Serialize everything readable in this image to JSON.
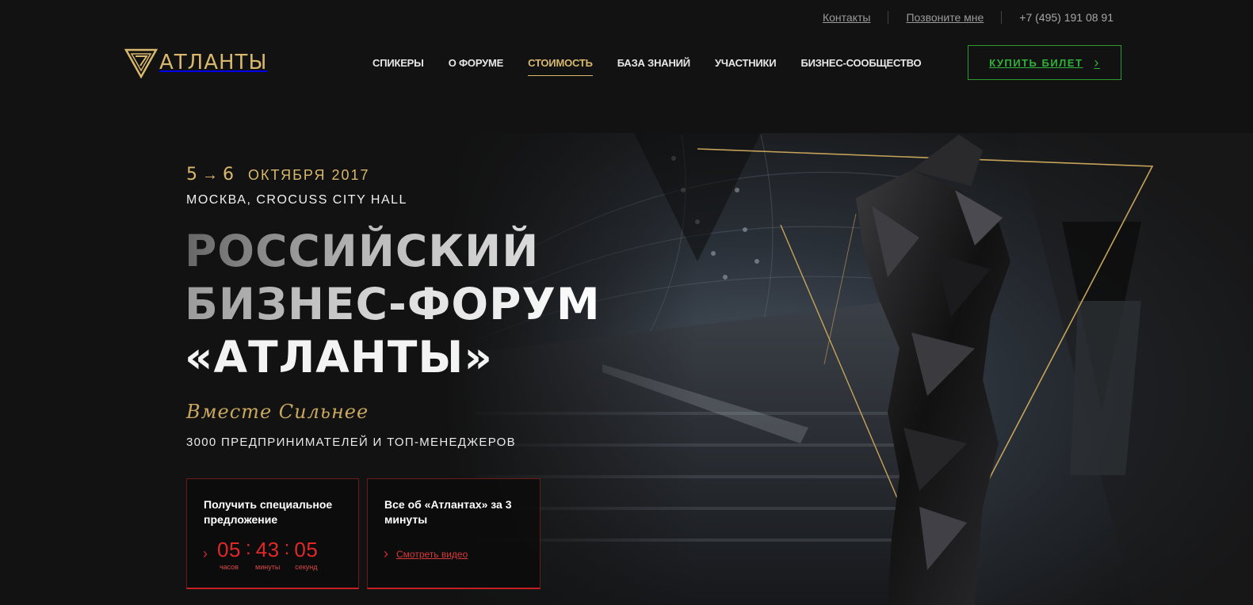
{
  "topbar": {
    "contacts": "Контакты",
    "callback": "Позвоните мне",
    "phone": "+7 (495) 191 08 91"
  },
  "logo": {
    "text": "АТЛАНТЫ",
    "icon": "atlanty-triangle-logo"
  },
  "nav": {
    "items": [
      {
        "label": "Спикеры"
      },
      {
        "label": "О форуме"
      },
      {
        "label": "Стоимость",
        "active": true
      },
      {
        "label": "База знаний"
      },
      {
        "label": "Участники"
      },
      {
        "label": "Бизнес-сообщество"
      }
    ]
  },
  "buy_button": {
    "label": "Купить билет",
    "icon": "chevron-right-icon"
  },
  "hero": {
    "date_start": "5",
    "date_arrow": "→",
    "date_end": "6",
    "month_year": "октября 2017",
    "location": "Москва, Crocuss City Hall",
    "headline_1": "Российский",
    "headline_2": "бизнес-форум",
    "headline_3": "«Атланты»",
    "slogan": "Вместе Сильнее",
    "audience": "3000 предпринимателей и топ-менеджеров"
  },
  "offer_card": {
    "title": "Получить специальное предложение",
    "hours": "05",
    "minutes": "43",
    "seconds": "05",
    "hours_label": "часов",
    "minutes_label": "минуты",
    "seconds_label": "секунд",
    "separator": ":"
  },
  "video_card": {
    "title": "Все об «Атлантах» за 3 минуты",
    "link": "Смотреть видео",
    "icon": "chevron-right-icon"
  },
  "colors": {
    "background": "#121212",
    "gold": "#d8b86c",
    "green": "#2fb13a",
    "red": "#e02828"
  }
}
